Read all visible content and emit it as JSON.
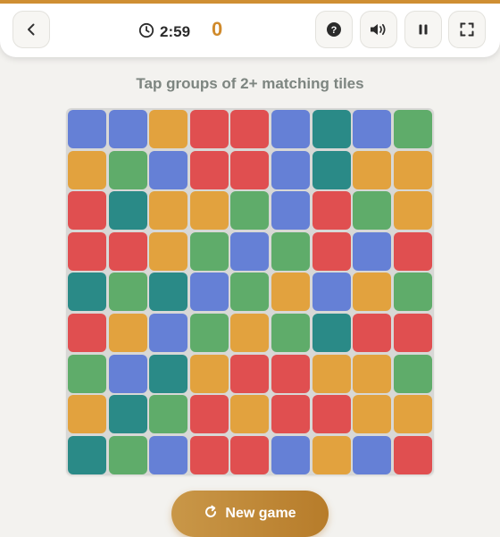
{
  "header": {
    "timer": "2:59",
    "score": "0"
  },
  "instructions": "Tap groups of 2+ matching tiles",
  "new_game_label": "New game",
  "icons": {
    "back": "chevron-left-icon",
    "timer": "clock-icon",
    "help": "question-icon",
    "sound": "speaker-icon",
    "pause": "pause-icon",
    "fullscreen": "fullscreen-icon",
    "restart": "refresh-icon"
  },
  "colors": {
    "B": "#6580d6",
    "O": "#e2a23e",
    "R": "#e04f50",
    "T": "#2a8a87",
    "G": "#5fac6a",
    "accent": "#cf8f33"
  },
  "board": [
    [
      "B",
      "B",
      "O",
      "R",
      "R",
      "B",
      "T",
      "B",
      "G"
    ],
    [
      "O",
      "G",
      "B",
      "R",
      "R",
      "B",
      "T",
      "O",
      "O"
    ],
    [
      "R",
      "T",
      "O",
      "O",
      "G",
      "B",
      "R",
      "G",
      "O"
    ],
    [
      "R",
      "R",
      "O",
      "G",
      "B",
      "G",
      "R",
      "B",
      "R"
    ],
    [
      "T",
      "G",
      "T",
      "B",
      "G",
      "O",
      "B",
      "O",
      "G"
    ],
    [
      "R",
      "O",
      "B",
      "G",
      "O",
      "G",
      "T",
      "R",
      "R"
    ],
    [
      "G",
      "B",
      "T",
      "O",
      "R",
      "R",
      "O",
      "O",
      "G"
    ],
    [
      "O",
      "T",
      "G",
      "R",
      "O",
      "R",
      "R",
      "O",
      "O"
    ],
    [
      "T",
      "G",
      "B",
      "R",
      "R",
      "B",
      "O",
      "B",
      "R"
    ]
  ]
}
